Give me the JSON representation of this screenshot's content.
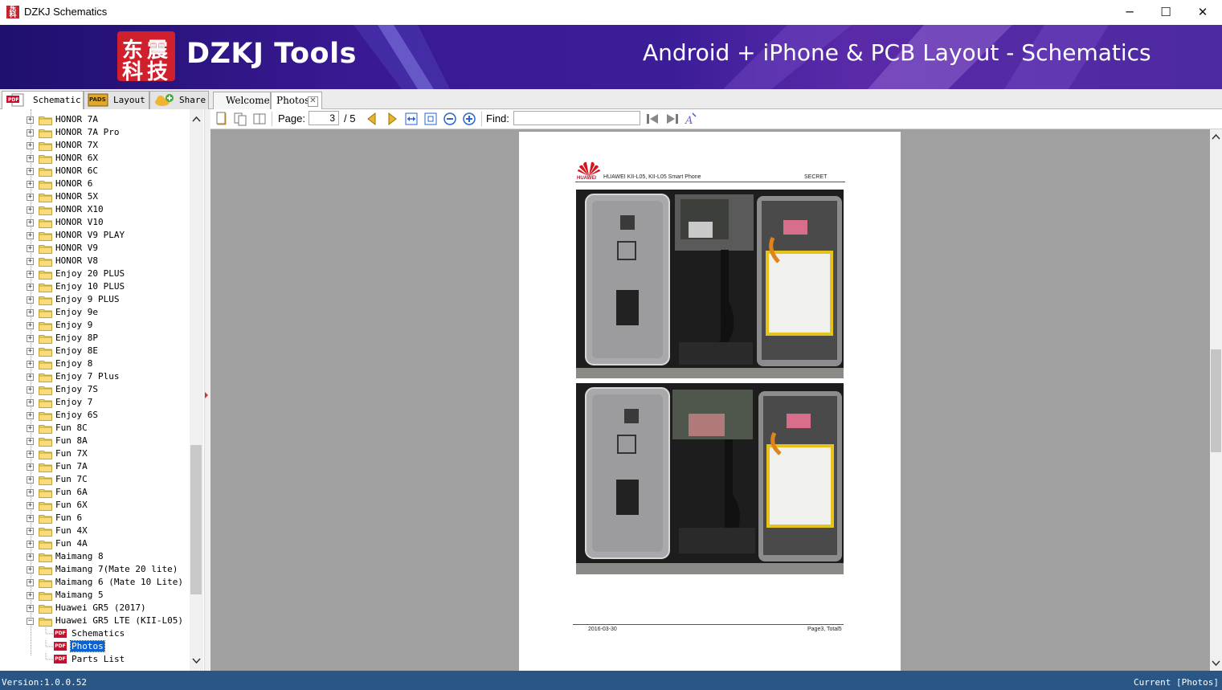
{
  "window": {
    "title": "DZKJ Schematics",
    "controls": {
      "minimize": "─",
      "maximize": "☐",
      "close": "✕"
    }
  },
  "banner": {
    "logo_chars": [
      "东",
      "震",
      "科",
      "技"
    ],
    "brand": "DZKJ Tools",
    "tagline": "Android + iPhone & PCB Layout - Schematics"
  },
  "left_tabs": [
    {
      "label": "Schematic",
      "icon": "pdf-icon",
      "active": true
    },
    {
      "label": "Layout",
      "icon": "pads-icon",
      "active": false
    },
    {
      "label": "Share",
      "icon": "cloud-share-icon",
      "active": false
    }
  ],
  "doc_tabs": [
    {
      "label": "Welcome",
      "active": false
    },
    {
      "label": "Photos",
      "active": true,
      "closable": true
    }
  ],
  "tree": {
    "items": [
      "HONOR 7A",
      "HONOR 7A Pro",
      "HONOR 7X",
      "HONOR 6X",
      "HONOR 6C",
      "HONOR 6",
      "HONOR 5X",
      "HONOR X10",
      "HONOR V10",
      "HONOR V9 PLAY",
      "HONOR V9",
      "HONOR V8",
      "Enjoy 20 PLUS",
      "Enjoy 10 PLUS",
      "Enjoy 9 PLUS",
      "Enjoy 9e",
      "Enjoy 9",
      "Enjoy 8P",
      "Enjoy 8E",
      "Enjoy 8",
      "Enjoy 7 Plus",
      "Enjoy 7S",
      "Enjoy 7",
      "Enjoy 6S",
      "Fun 8C",
      "Fun 8A",
      "Fun 7X",
      "Fun 7A",
      "Fun 7C",
      "Fun 6A",
      "Fun 6X",
      "Fun 6",
      "Fun 4X",
      "Fun 4A",
      "Maimang 8",
      "Maimang 7(Mate 20 lite)",
      "Maimang 6 (Mate 10 Lite)",
      "Maimang 5",
      "Huawei GR5 (2017)",
      "Huawei GR5 LTE (KII-L05)"
    ],
    "expanded_item": "Huawei GR5 LTE (KII-L05)",
    "children": [
      {
        "label": "Schematics",
        "selected": false
      },
      {
        "label": "Photos",
        "selected": true
      },
      {
        "label": "Parts List",
        "selected": false
      }
    ]
  },
  "toolbar": {
    "page_label": "Page:",
    "page_current": "3",
    "page_total": "/ 5",
    "find_label": "Find:",
    "find_value": ""
  },
  "document": {
    "brand": "HUAWEI",
    "header": "HUAWEI KII-L05, KII-L05 Smart Phone",
    "classification": "SECRET",
    "footer_date": "2016-03-30",
    "footer_page": "Page3, Total5"
  },
  "status": {
    "version": "Version:1.0.0.52",
    "current": "Current [Photos]"
  },
  "colors": {
    "banner": "#3a1a94",
    "logo_red": "#d01f2d",
    "status_bar": "#2a5685",
    "selection": "#0a63d6",
    "viewer_bg": "#a0a0a0"
  }
}
